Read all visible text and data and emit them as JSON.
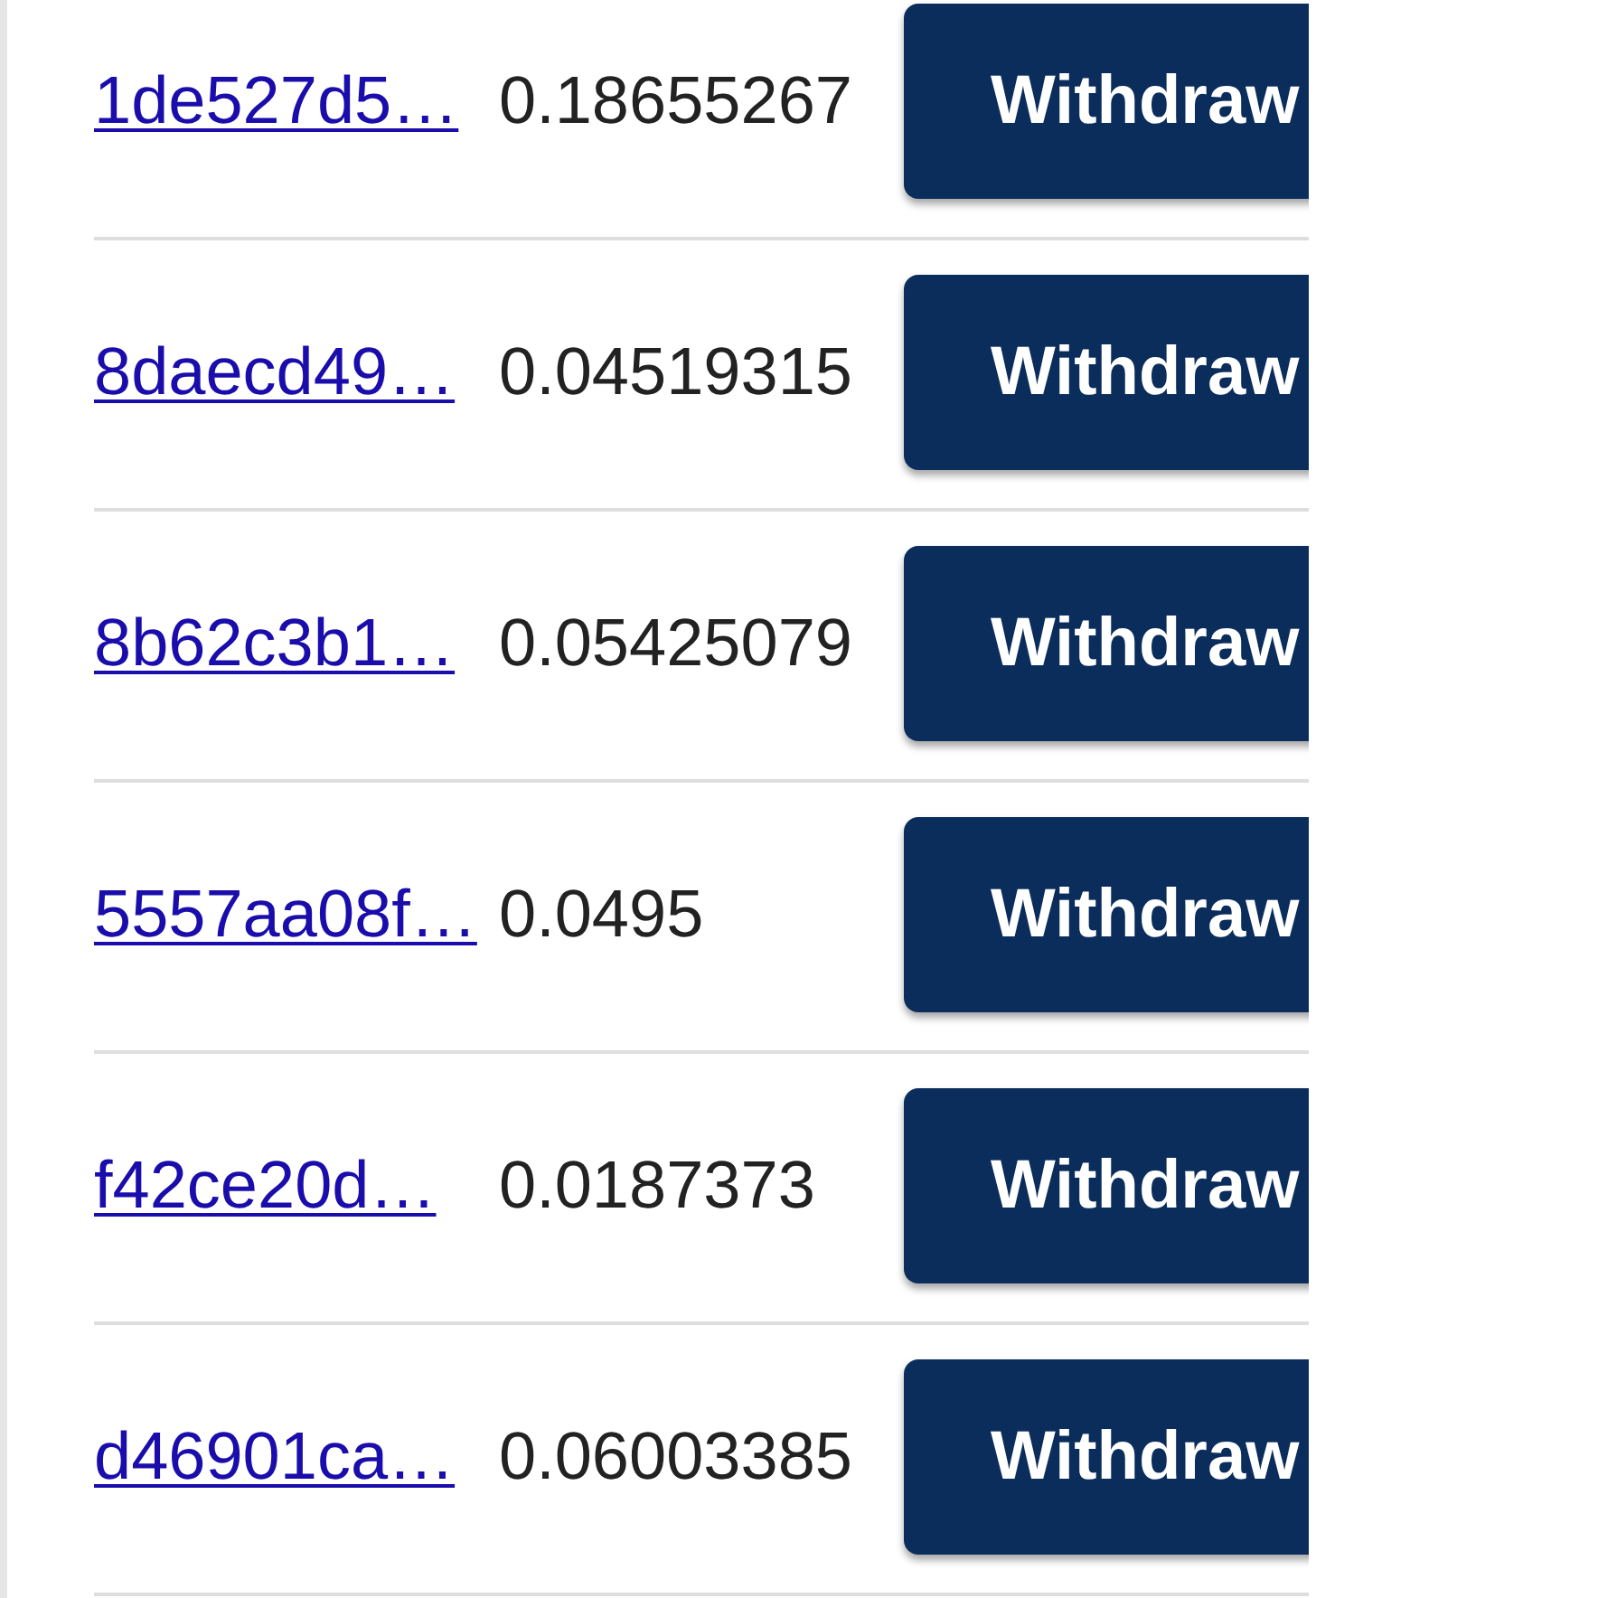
{
  "rows": [
    {
      "address": "1de527d5…",
      "amount": "0.18655267",
      "button": "Withdraw"
    },
    {
      "address": "8daecd49…",
      "amount": "0.04519315",
      "button": "Withdraw"
    },
    {
      "address": "8b62c3b1…",
      "amount": "0.05425079",
      "button": "Withdraw"
    },
    {
      "address": "5557aa08f…",
      "amount": "0.0495",
      "button": "Withdraw"
    },
    {
      "address": "f42ce20d…",
      "amount": "0.0187373",
      "button": "Withdraw"
    },
    {
      "address": "d46901ca…",
      "amount": "0.06003385",
      "button": "Withdraw"
    }
  ]
}
